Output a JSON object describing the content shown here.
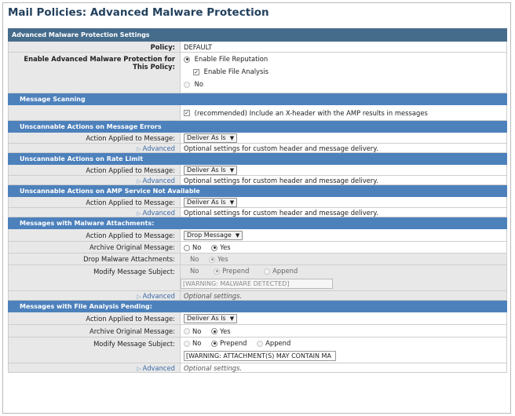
{
  "title": "Mail Policies: Advanced Malware Protection",
  "settings": {
    "header": "Advanced Malware Protection Settings",
    "policy_label": "Policy:",
    "policy_value": "DEFAULT",
    "enable_label": "Enable Advanced Malware Protection for This Policy:",
    "enable_file_reputation": "Enable File Reputation",
    "enable_file_analysis": "Enable File Analysis",
    "no_label": "No"
  },
  "message_scanning": {
    "header": "Message Scanning",
    "xheader_text": "(recommended) Include an X-header with the AMP results in messages"
  },
  "common": {
    "action_label": "Action Applied to Message:",
    "advanced_label": "Advanced",
    "optional_custom": "Optional settings for custom header and message delivery.",
    "optional_settings": "Optional settings.",
    "deliver_as_is": "Deliver As Is",
    "drop_message": "Drop Message",
    "archive_label": "Archive Original Message:",
    "modify_subject_label": "Modify Message Subject:",
    "drop_attachments_label": "Drop Malware Attachments:",
    "no": "No",
    "yes": "Yes",
    "prepend": "Prepend",
    "append": "Append"
  },
  "unscannable_errors": {
    "header": "Unscannable Actions on Message Errors"
  },
  "unscannable_rate": {
    "header": "Unscannable Actions on Rate Limit"
  },
  "unscannable_amp": {
    "header": "Unscannable Actions on AMP Service Not Available"
  },
  "malware_attachments": {
    "header": "Messages with Malware Attachments:",
    "subject_text": "[WARNING: MALWARE DETECTED]"
  },
  "file_analysis_pending": {
    "header": "Messages with File Analysis Pending:",
    "subject_text": "[WARNING: ATTACHMENT(S) MAY CONTAIN MA"
  }
}
